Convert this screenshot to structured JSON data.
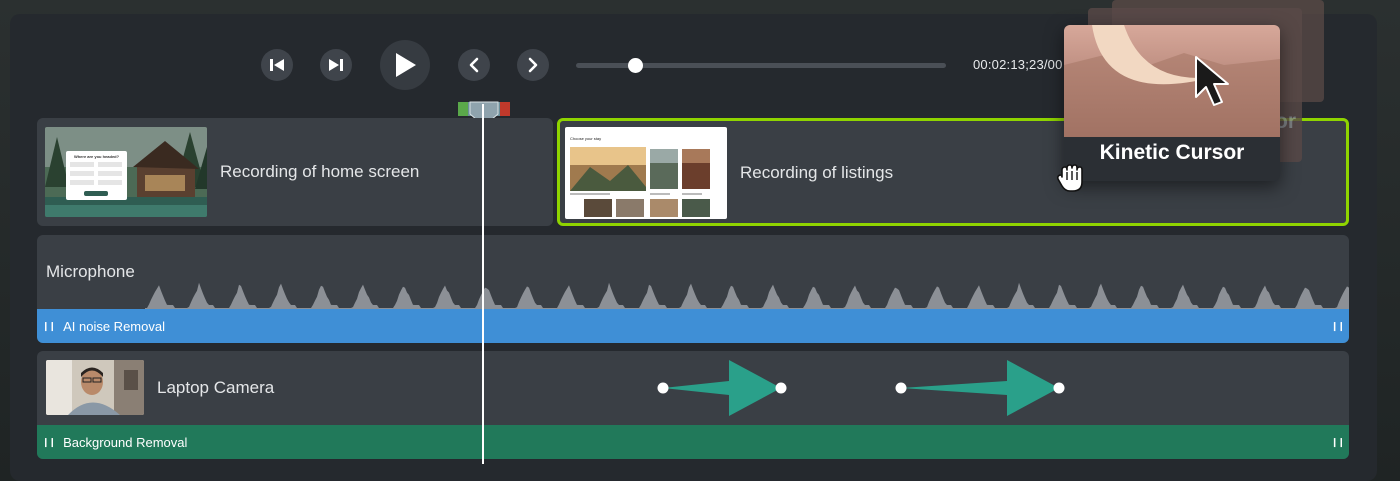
{
  "transport": {
    "timecode": "00:02:13;23/00",
    "scrub_progress": 0.16,
    "buttons": [
      "step-back-icon",
      "step-forward-icon",
      "play-icon",
      "previous-icon",
      "next-icon"
    ]
  },
  "tracks": {
    "video": {
      "clips": [
        {
          "label": "Recording of home screen",
          "selected": false,
          "thumb_text": {
            "heading": "Where are you headed?"
          }
        },
        {
          "label": "Recording of listings",
          "selected": true,
          "thumb_text": {
            "heading": "Choose your stay"
          }
        }
      ]
    },
    "audio": {
      "label": "Microphone",
      "effect": "AI noise Removal",
      "effect_color": "#3f8fd6"
    },
    "camera": {
      "label": "Laptop Camera",
      "effect": "Background Removal",
      "effect_color": "#21795a"
    }
  },
  "popover": {
    "title": "Kinetic Cursor",
    "behind_text": "or"
  },
  "colors": {
    "selection": "#8fd400",
    "playhead_green": "#5aa84a",
    "playhead_red": "#c0392b"
  }
}
